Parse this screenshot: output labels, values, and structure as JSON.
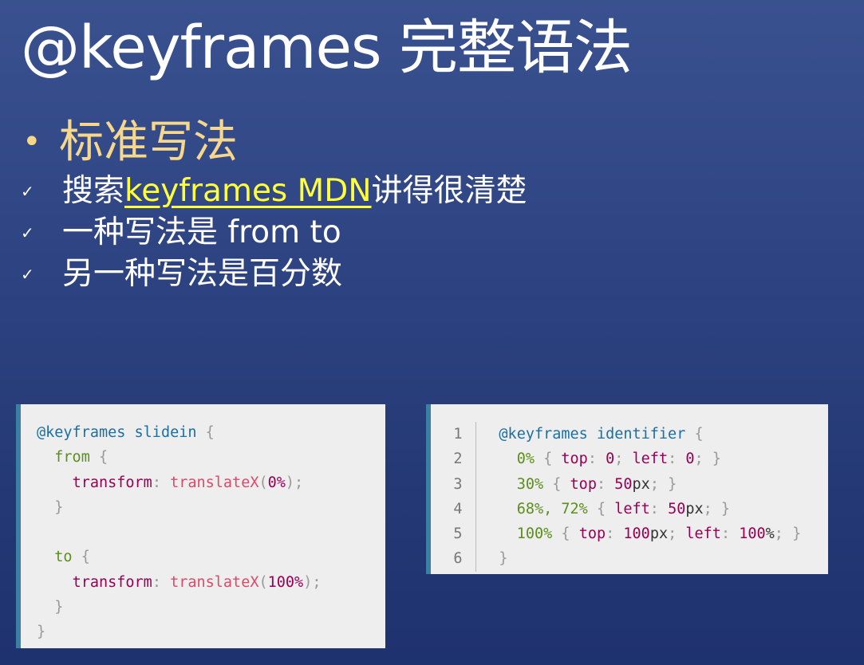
{
  "title": "@keyframes 完整语法",
  "main_bullet": "标准写法",
  "checks": [
    {
      "before": "搜索 ",
      "link": "keyframes MDN",
      "after": " 讲得很清楚"
    },
    {
      "text": "一种写法是 from to"
    },
    {
      "text": "另一种写法是百分数"
    }
  ],
  "code1": {
    "lines": [
      [
        {
          "t": "@keyframes",
          "c": "at"
        },
        {
          "t": " slidein ",
          "c": "at"
        },
        {
          "t": "{",
          "c": "punc"
        }
      ],
      [
        {
          "t": "  "
        },
        {
          "t": "from",
          "c": "sel"
        },
        {
          "t": " "
        },
        {
          "t": "{",
          "c": "punc"
        }
      ],
      [
        {
          "t": "    "
        },
        {
          "t": "transform",
          "c": "prop"
        },
        {
          "t": ": ",
          "c": "punc"
        },
        {
          "t": "translateX",
          "c": "fn"
        },
        {
          "t": "(",
          "c": "punc"
        },
        {
          "t": "0%",
          "c": "num"
        },
        {
          "t": ");",
          "c": "punc"
        }
      ],
      [
        {
          "t": "  "
        },
        {
          "t": "}",
          "c": "punc"
        }
      ],
      [
        {
          "t": ""
        }
      ],
      [
        {
          "t": "  "
        },
        {
          "t": "to",
          "c": "sel"
        },
        {
          "t": " "
        },
        {
          "t": "{",
          "c": "punc"
        }
      ],
      [
        {
          "t": "    "
        },
        {
          "t": "transform",
          "c": "prop"
        },
        {
          "t": ": ",
          "c": "punc"
        },
        {
          "t": "translateX",
          "c": "fn"
        },
        {
          "t": "(",
          "c": "punc"
        },
        {
          "t": "100%",
          "c": "num"
        },
        {
          "t": ");",
          "c": "punc"
        }
      ],
      [
        {
          "t": "  "
        },
        {
          "t": "}",
          "c": "punc"
        }
      ],
      [
        {
          "t": "}",
          "c": "punc"
        }
      ]
    ]
  },
  "code2": {
    "line_numbers": [
      "1",
      "2",
      "3",
      "4",
      "5",
      "6"
    ],
    "lines": [
      [
        {
          "t": "@keyframes",
          "c": "at"
        },
        {
          "t": " identifier ",
          "c": "at"
        },
        {
          "t": "{",
          "c": "punc"
        }
      ],
      [
        {
          "t": "  "
        },
        {
          "t": "0%",
          "c": "sel"
        },
        {
          "t": " "
        },
        {
          "t": "{",
          "c": "punc"
        },
        {
          "t": " "
        },
        {
          "t": "top",
          "c": "prop"
        },
        {
          "t": ": ",
          "c": "punc"
        },
        {
          "t": "0",
          "c": "num"
        },
        {
          "t": "; ",
          "c": "punc"
        },
        {
          "t": "left",
          "c": "prop"
        },
        {
          "t": ": ",
          "c": "punc"
        },
        {
          "t": "0",
          "c": "num"
        },
        {
          "t": "; ",
          "c": "punc"
        },
        {
          "t": "}",
          "c": "punc"
        }
      ],
      [
        {
          "t": "  "
        },
        {
          "t": "30%",
          "c": "sel"
        },
        {
          "t": " "
        },
        {
          "t": "{",
          "c": "punc"
        },
        {
          "t": " "
        },
        {
          "t": "top",
          "c": "prop"
        },
        {
          "t": ": ",
          "c": "punc"
        },
        {
          "t": "50",
          "c": "num"
        },
        {
          "t": "px",
          "c": "plain"
        },
        {
          "t": "; ",
          "c": "punc"
        },
        {
          "t": "}",
          "c": "punc"
        }
      ],
      [
        {
          "t": "  "
        },
        {
          "t": "68%, 72%",
          "c": "sel"
        },
        {
          "t": " "
        },
        {
          "t": "{",
          "c": "punc"
        },
        {
          "t": " "
        },
        {
          "t": "left",
          "c": "prop"
        },
        {
          "t": ": ",
          "c": "punc"
        },
        {
          "t": "50",
          "c": "num"
        },
        {
          "t": "px",
          "c": "plain"
        },
        {
          "t": "; ",
          "c": "punc"
        },
        {
          "t": "}",
          "c": "punc"
        }
      ],
      [
        {
          "t": "  "
        },
        {
          "t": "100%",
          "c": "sel"
        },
        {
          "t": " "
        },
        {
          "t": "{",
          "c": "punc"
        },
        {
          "t": " "
        },
        {
          "t": "top",
          "c": "prop"
        },
        {
          "t": ": ",
          "c": "punc"
        },
        {
          "t": "100",
          "c": "num"
        },
        {
          "t": "px",
          "c": "plain"
        },
        {
          "t": "; ",
          "c": "punc"
        },
        {
          "t": "left",
          "c": "prop"
        },
        {
          "t": ": ",
          "c": "punc"
        },
        {
          "t": "100",
          "c": "num"
        },
        {
          "t": "%",
          "c": "plain"
        },
        {
          "t": "; ",
          "c": "punc"
        },
        {
          "t": "}",
          "c": "punc"
        }
      ],
      [
        {
          "t": "}",
          "c": "punc"
        }
      ]
    ]
  }
}
